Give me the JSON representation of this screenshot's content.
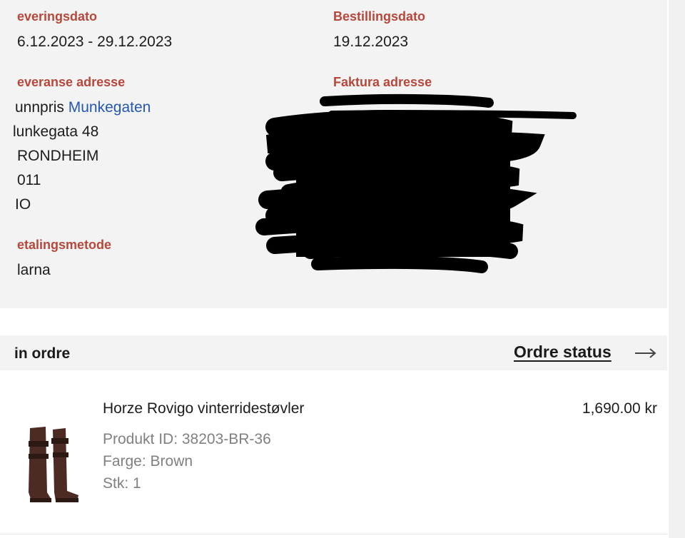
{
  "delivery": {
    "date_label": "everingsdato",
    "date_value": "6.12.2023 - 29.12.2023",
    "address_label": "everanse adresse",
    "address_store_prefix": "unnpris",
    "address_store_link": "Munkegaten",
    "address_lines": [
      "lunkegata 48",
      "RONDHEIM",
      "011",
      "IO"
    ]
  },
  "order_date": {
    "label": "Bestillingsdato",
    "value": "19.12.2023"
  },
  "invoice": {
    "label": "Faktura adresse"
  },
  "payment": {
    "label": "etalingsmetode",
    "value": "larna"
  },
  "order": {
    "title": "in ordre",
    "status_link": "Ordre status"
  },
  "item": {
    "name": "Horze Rovigo vinterridestøvler",
    "price": "1,690.00 kr",
    "product_id": "Produkt ID: 38203-BR-36",
    "color": "Farge: Brown",
    "quantity": "Stk: 1"
  },
  "colors": {
    "label_red": "#b8473b",
    "link_blue": "#2457b4",
    "panel_gray": "#f3f3f3"
  },
  "icons": [
    "right-arrow-icon",
    "boot-image"
  ]
}
